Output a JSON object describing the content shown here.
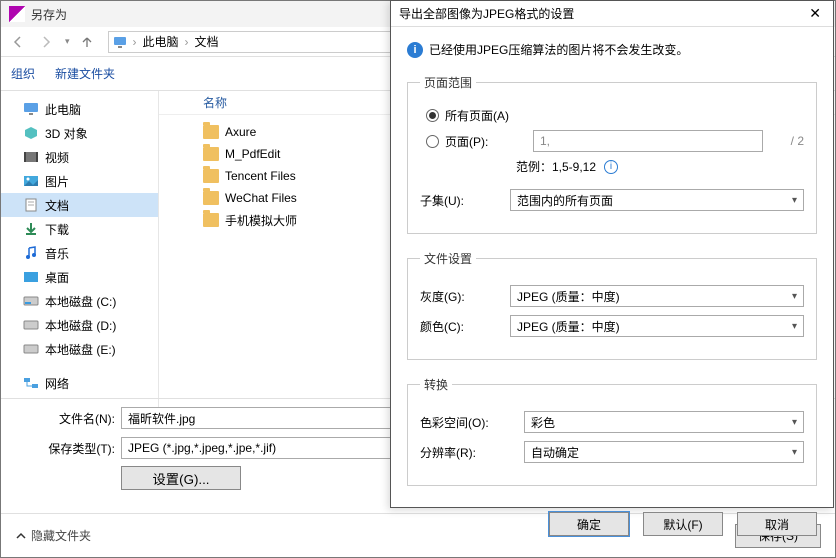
{
  "saveas": {
    "title": "另存为",
    "breadcrumb": {
      "root": "此电脑",
      "folder": "文档"
    },
    "toolbar": {
      "organize": "组织",
      "new_folder": "新建文件夹"
    },
    "sidebar": {
      "items": [
        {
          "label": "此电脑"
        },
        {
          "label": "3D 对象"
        },
        {
          "label": "视频"
        },
        {
          "label": "图片"
        },
        {
          "label": "文档"
        },
        {
          "label": "下载"
        },
        {
          "label": "音乐"
        },
        {
          "label": "桌面"
        },
        {
          "label": "本地磁盘 (C:)"
        },
        {
          "label": "本地磁盘 (D:)"
        },
        {
          "label": "本地磁盘 (E:)"
        },
        {
          "label": "网络"
        }
      ]
    },
    "content": {
      "column_header": "名称",
      "folders": [
        {
          "name": "Axure"
        },
        {
          "name": "M_PdfEdit"
        },
        {
          "name": "Tencent Files"
        },
        {
          "name": "WeChat Files"
        },
        {
          "name": "手机模拟大师"
        }
      ]
    },
    "filename_label": "文件名(N):",
    "filename_value": "福昕软件.jpg",
    "filetype_label": "保存类型(T):",
    "filetype_value": "JPEG (*.jpg,*.jpeg,*.jpe,*.jif)",
    "settings_button": "设置(G)...",
    "hide_folders": "隐藏文件夹",
    "save_button": "保存(S)"
  },
  "settings": {
    "title": "导出全部图像为JPEG格式的设置",
    "info": "已经使用JPEG压缩算法的图片将不会发生改变。",
    "legend_page_range": "页面范围",
    "radio_all_pages": "所有页面(A)",
    "radio_pages": "页面(P):",
    "page_input_placeholder": "1,",
    "total_pages": "/  2",
    "example_label": "范例：1,5-9,12",
    "subset_label": "子集(U):",
    "subset_value": "范围内的所有页面",
    "legend_file_settings": "文件设置",
    "gray_label": "灰度(G):",
    "gray_value": "JPEG (质量：中度)",
    "color_label": "颜色(C):",
    "color_value": "JPEG (质量：中度)",
    "legend_transform": "转换",
    "colorspace_label": "色彩空间(O):",
    "colorspace_value": "彩色",
    "resolution_label": "分辨率(R):",
    "resolution_value": "自动确定",
    "btn_ok": "确定",
    "btn_default": "默认(F)",
    "btn_cancel": "取消"
  }
}
